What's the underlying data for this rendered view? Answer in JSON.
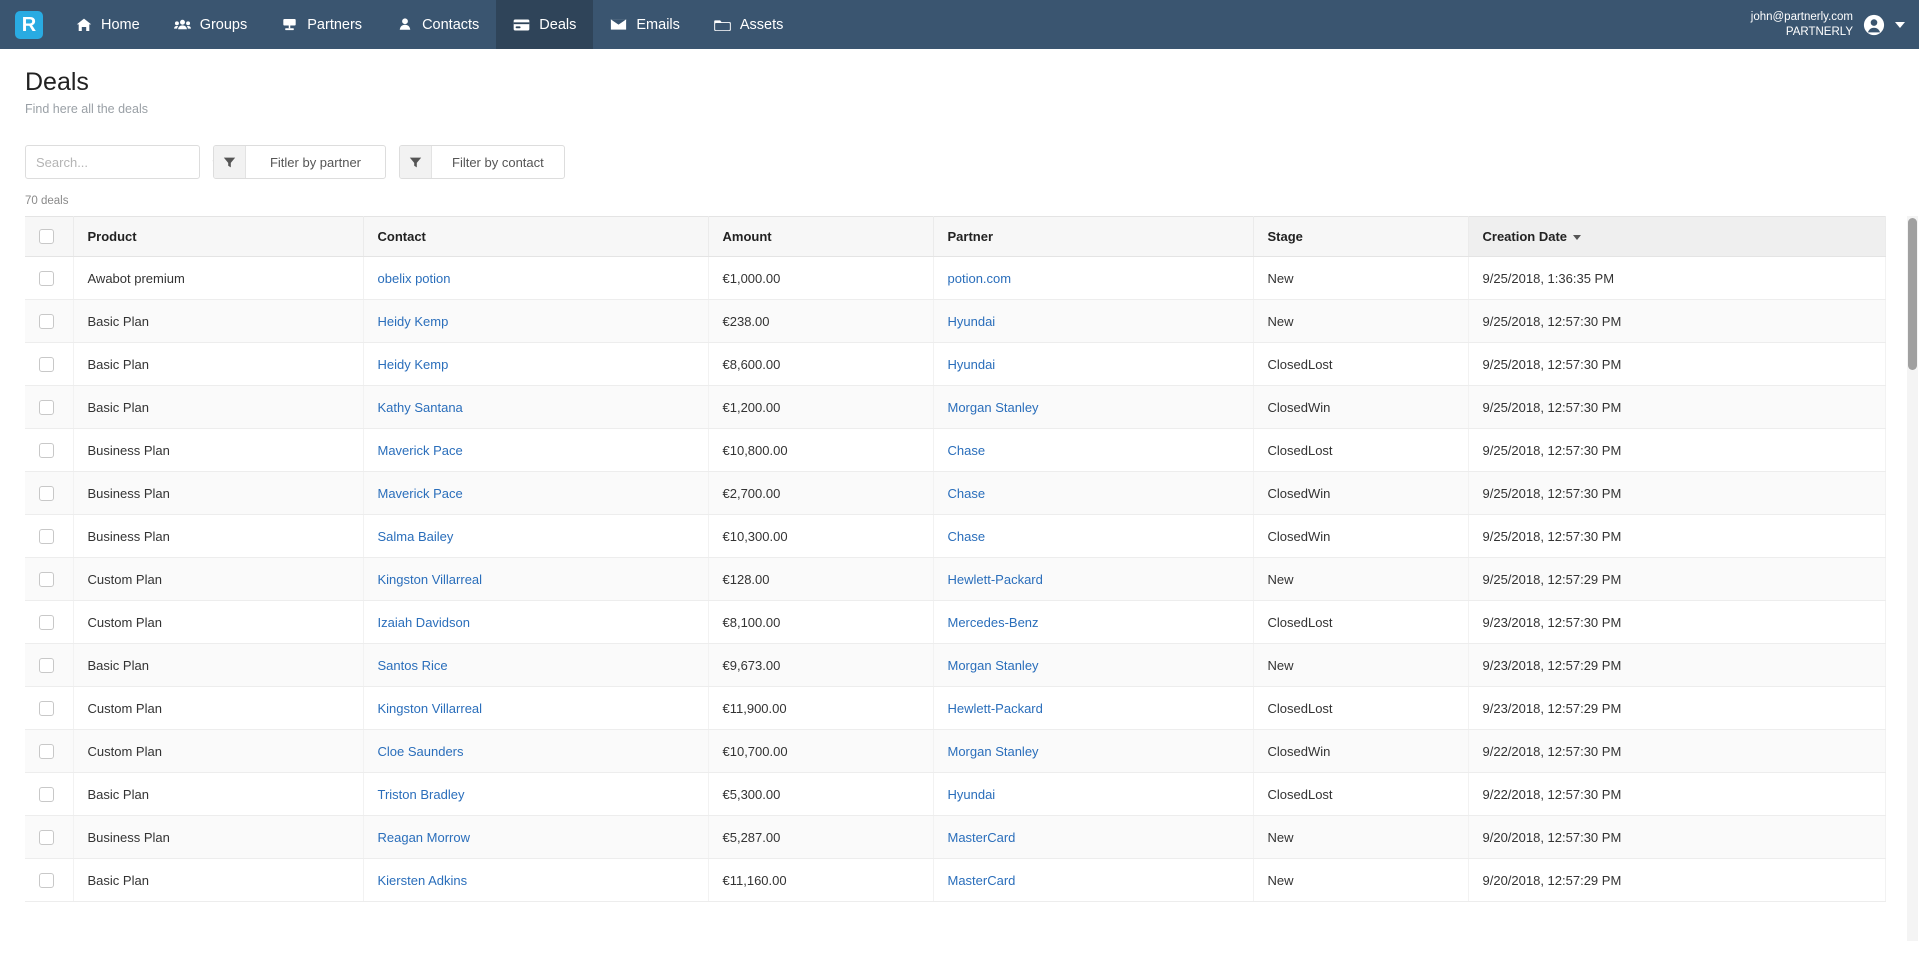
{
  "navbar": {
    "logo_letter": "R",
    "items": [
      {
        "label": "Home",
        "icon": "home-icon",
        "active": false
      },
      {
        "label": "Groups",
        "icon": "groups-icon",
        "active": false
      },
      {
        "label": "Partners",
        "icon": "partners-icon",
        "active": false
      },
      {
        "label": "Contacts",
        "icon": "contacts-icon",
        "active": false
      },
      {
        "label": "Deals",
        "icon": "deals-icon",
        "active": true
      },
      {
        "label": "Emails",
        "icon": "emails-icon",
        "active": false
      },
      {
        "label": "Assets",
        "icon": "assets-icon",
        "active": false
      }
    ],
    "user": {
      "email": "john@partnerly.com",
      "org": "PARTNERLY",
      "avatar_icon": "user-avatar-icon",
      "caret_icon": "chevron-down-icon"
    },
    "bg_color": "#3a5570",
    "active_bg_color": "#2f4459",
    "logo_color": "#29abe2"
  },
  "header": {
    "title": "Deals",
    "subtitle": "Find here all the deals"
  },
  "toolbar": {
    "search_placeholder": "Search...",
    "search_value": "",
    "search_icon": "search-icon",
    "filter_partner_label": "Fitler by partner",
    "filter_contact_label": "Filter by contact",
    "filter_icon": "filter-funnel-icon"
  },
  "count_label": "70 deals",
  "table": {
    "columns": [
      {
        "key": "product",
        "label": "Product",
        "sorted": false
      },
      {
        "key": "contact",
        "label": "Contact",
        "sorted": false
      },
      {
        "key": "amount",
        "label": "Amount",
        "sorted": false
      },
      {
        "key": "partner",
        "label": "Partner",
        "sorted": false
      },
      {
        "key": "stage",
        "label": "Stage",
        "sorted": false
      },
      {
        "key": "date",
        "label": "Creation Date",
        "sorted": true,
        "sort_dir": "desc"
      }
    ],
    "link_color": "#2a6ebb",
    "rows": [
      {
        "product": "Awabot premium",
        "contact": "obelix potion",
        "amount": "€1,000.00",
        "partner": "potion.com",
        "stage": "New",
        "date": "9/25/2018, 1:36:35 PM"
      },
      {
        "product": "Basic Plan",
        "contact": "Heidy Kemp",
        "amount": "€238.00",
        "partner": "Hyundai",
        "stage": "New",
        "date": "9/25/2018, 12:57:30 PM"
      },
      {
        "product": "Basic Plan",
        "contact": "Heidy Kemp",
        "amount": "€8,600.00",
        "partner": "Hyundai",
        "stage": "ClosedLost",
        "date": "9/25/2018, 12:57:30 PM"
      },
      {
        "product": "Basic Plan",
        "contact": "Kathy Santana",
        "amount": "€1,200.00",
        "partner": "Morgan Stanley",
        "stage": "ClosedWin",
        "date": "9/25/2018, 12:57:30 PM"
      },
      {
        "product": "Business Plan",
        "contact": "Maverick Pace",
        "amount": "€10,800.00",
        "partner": "Chase",
        "stage": "ClosedLost",
        "date": "9/25/2018, 12:57:30 PM"
      },
      {
        "product": "Business Plan",
        "contact": "Maverick Pace",
        "amount": "€2,700.00",
        "partner": "Chase",
        "stage": "ClosedWin",
        "date": "9/25/2018, 12:57:30 PM"
      },
      {
        "product": "Business Plan",
        "contact": "Salma Bailey",
        "amount": "€10,300.00",
        "partner": "Chase",
        "stage": "ClosedWin",
        "date": "9/25/2018, 12:57:30 PM"
      },
      {
        "product": "Custom Plan",
        "contact": "Kingston Villarreal",
        "amount": "€128.00",
        "partner": "Hewlett-Packard",
        "stage": "New",
        "date": "9/25/2018, 12:57:29 PM"
      },
      {
        "product": "Custom Plan",
        "contact": "Izaiah Davidson",
        "amount": "€8,100.00",
        "partner": "Mercedes-Benz",
        "stage": "ClosedLost",
        "date": "9/23/2018, 12:57:30 PM"
      },
      {
        "product": "Basic Plan",
        "contact": "Santos Rice",
        "amount": "€9,673.00",
        "partner": "Morgan Stanley",
        "stage": "New",
        "date": "9/23/2018, 12:57:29 PM"
      },
      {
        "product": "Custom Plan",
        "contact": "Kingston Villarreal",
        "amount": "€11,900.00",
        "partner": "Hewlett-Packard",
        "stage": "ClosedLost",
        "date": "9/23/2018, 12:57:29 PM"
      },
      {
        "product": "Custom Plan",
        "contact": "Cloe Saunders",
        "amount": "€10,700.00",
        "partner": "Morgan Stanley",
        "stage": "ClosedWin",
        "date": "9/22/2018, 12:57:30 PM"
      },
      {
        "product": "Basic Plan",
        "contact": "Triston Bradley",
        "amount": "€5,300.00",
        "partner": "Hyundai",
        "stage": "ClosedLost",
        "date": "9/22/2018, 12:57:30 PM"
      },
      {
        "product": "Business Plan",
        "contact": "Reagan Morrow",
        "amount": "€5,287.00",
        "partner": "MasterCard",
        "stage": "New",
        "date": "9/20/2018, 12:57:30 PM"
      },
      {
        "product": "Basic Plan",
        "contact": "Kiersten Adkins",
        "amount": "€11,160.00",
        "partner": "MasterCard",
        "stage": "New",
        "date": "9/20/2018, 12:57:29 PM"
      }
    ]
  }
}
